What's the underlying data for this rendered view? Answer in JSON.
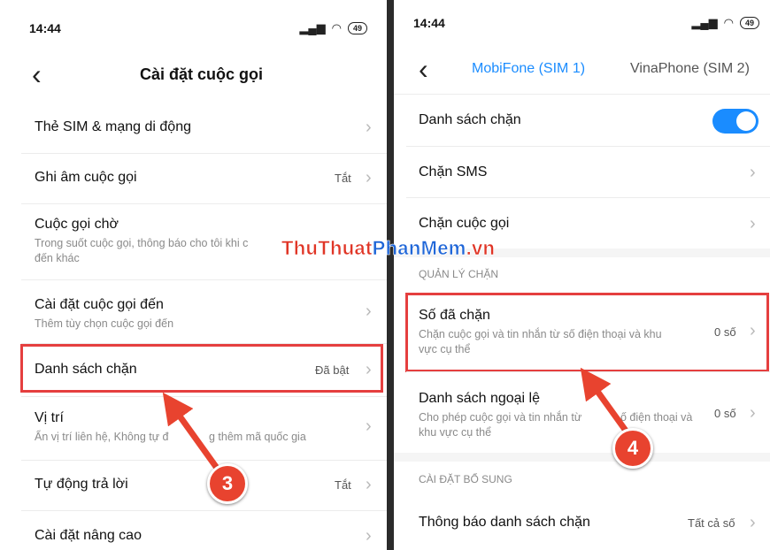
{
  "left": {
    "status": {
      "time": "14:44",
      "battery": "49"
    },
    "header": {
      "title": "Cài đặt cuộc gọi"
    },
    "items": [
      {
        "title": "Thẻ SIM & mạng di động",
        "subtitle": "",
        "value": ""
      },
      {
        "title": "Ghi âm cuộc gọi",
        "subtitle": "",
        "value": "Tắt"
      },
      {
        "title": "Cuộc gọi chờ",
        "subtitle": "Trong suốt cuộc gọi, thông báo cho tôi khi c",
        "subtitle2": "đến khác",
        "value": ""
      },
      {
        "title": "Cài đặt cuộc gọi đến",
        "subtitle": "Thêm tùy chọn cuộc gọi đến",
        "value": ""
      },
      {
        "title": "Danh sách chặn",
        "subtitle": "",
        "value": "Đã bật"
      },
      {
        "title": "Vị trí",
        "subtitle": "Ẩn vị trí liên hệ, Không tự đ",
        "subtitle_end": "g thêm mã quốc gia",
        "value": ""
      },
      {
        "title": "Tự động trả lời",
        "subtitle": "",
        "value": "Tắt"
      },
      {
        "title": "Cài đặt nâng cao",
        "subtitle": "",
        "value": ""
      }
    ],
    "step_badge": "3"
  },
  "right": {
    "status": {
      "time": "14:44",
      "battery": "49"
    },
    "tabs": [
      {
        "label": "MobiFone (SIM 1)",
        "active": true
      },
      {
        "label": "VinaPhone (SIM 2)",
        "active": false
      }
    ],
    "items_top": [
      {
        "title": "Danh sách chặn",
        "toggle_on": true
      },
      {
        "title": "Chặn SMS"
      },
      {
        "title": "Chặn cuộc gọi"
      }
    ],
    "section1": "QUẢN LÝ CHẶN",
    "items_mid": [
      {
        "title": "Số đã chặn",
        "subtitle": "Chặn cuộc gọi và tin nhắn từ số điện thoại và khu",
        "subtitle2": "vực cụ thể",
        "value": "0 số"
      },
      {
        "title": "Danh sách ngoại lệ",
        "subtitle": "Cho phép cuộc gọi và tin nhắn từ",
        "subtitle_end": "ố điện thoại và",
        "subtitle2": "khu vực cụ thể",
        "value": "0 số"
      }
    ],
    "section2": "CÀI ĐẶT BỔ SUNG",
    "items_bottom": [
      {
        "title": "Thông báo danh sách chặn",
        "value": "Tất cả số"
      }
    ],
    "step_badge": "4"
  },
  "watermark": {
    "part1": "ThuThuat",
    "part2": "PhanMem",
    "part3": ".vn"
  },
  "colors": {
    "accent": "#1a8cff",
    "highlight": "#e53f3f",
    "badge": "#e8432f"
  }
}
